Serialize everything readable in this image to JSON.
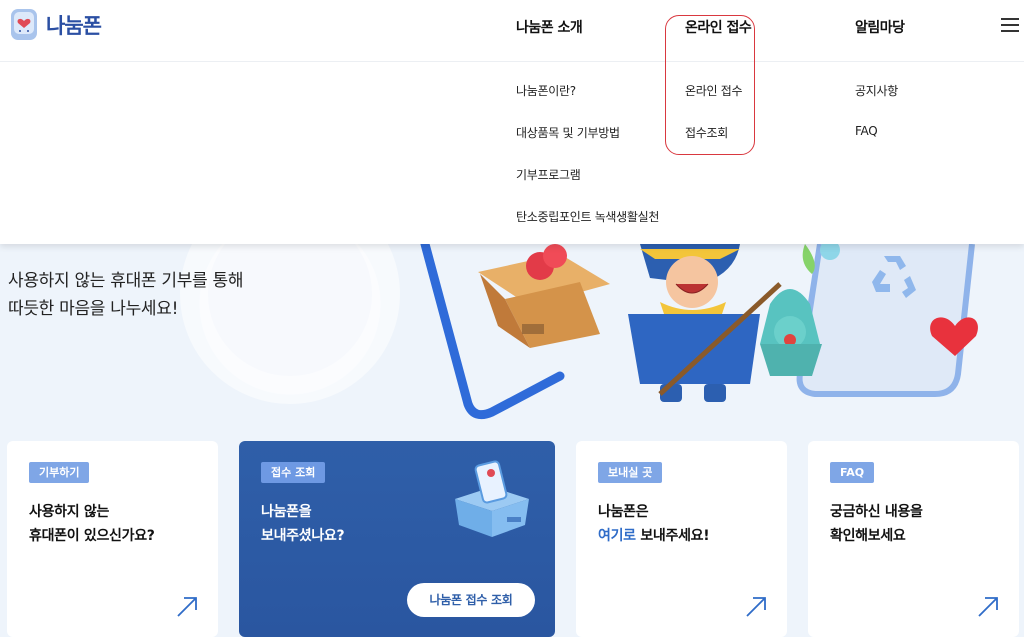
{
  "brand": {
    "name": "나눔폰"
  },
  "nav": {
    "about": "나눔폰 소개",
    "online": "온라인 접수",
    "notice": "알림마당"
  },
  "dropdown": {
    "about": [
      "나눔폰이란?",
      "대상품목 및 기부방법",
      "기부프로그램",
      "탄소중립포인트 녹색생활실천"
    ],
    "online": [
      "온라인 접수",
      "접수조회"
    ],
    "notice": [
      "공지사항",
      "FAQ"
    ]
  },
  "hero": {
    "line1": "사용하지 않는 휴대폰 기부를 통해",
    "line2": "따듯한 마음을 나누세요!"
  },
  "cards": [
    {
      "badge": "기부하기",
      "line1": "사용하지 않는",
      "line2": "휴대폰이 있으신가요?"
    },
    {
      "badge": "접수 조회",
      "line1": "나눔폰을",
      "line2": "보내주셨나요?",
      "button": "나눔폰 접수 조회"
    },
    {
      "badge": "보내실 곳",
      "line1": "나눔폰은",
      "line2_accent": "여기로",
      "line2_rest": " 보내주세요!"
    },
    {
      "badge": "FAQ",
      "line1": "궁금하신 내용을",
      "line2": "확인해보세요"
    }
  ],
  "colors": {
    "brand": "#2b4fa3",
    "highlight": "#d9383f",
    "card_blue": "#2f5fa9",
    "badge": "#7fa6e6"
  },
  "icons": [
    "logo-mascot-icon",
    "hamburger-menu-icon",
    "arrow-up-right-icon",
    "box-phone-icon"
  ]
}
